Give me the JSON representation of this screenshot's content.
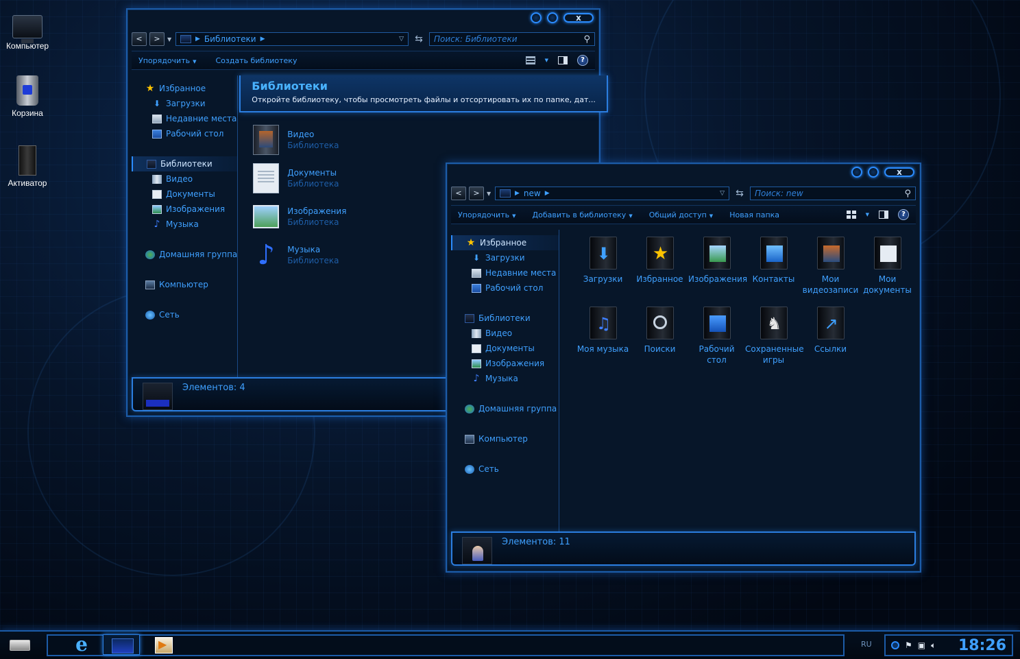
{
  "desktop": {
    "icons": [
      {
        "label": "Компьютер",
        "icon": "computer-icon"
      },
      {
        "label": "Корзина",
        "icon": "recycle-bin-icon"
      },
      {
        "label": "Активатор",
        "icon": "activator-icon"
      }
    ]
  },
  "window1": {
    "address": {
      "crumb": "Библиотеки"
    },
    "search_placeholder": "Поиск: Библиотеки",
    "toolbar": {
      "organize": "Упорядочить",
      "create_library": "Создать библиотеку"
    },
    "nav": {
      "favorites": "Избранное",
      "downloads": "Загрузки",
      "recent": "Недавние места",
      "desktop": "Рабочий стол",
      "libraries": "Библиотеки",
      "video": "Видео",
      "documents": "Документы",
      "images": "Изображения",
      "music": "Музыка",
      "homegroup": "Домашняя группа",
      "computer": "Компьютер",
      "network": "Сеть"
    },
    "banner": {
      "title": "Библиотеки",
      "subtitle": "Откройте библиотеку, чтобы просмотреть файлы и отсортировать их по папке, дат..."
    },
    "libraries": [
      {
        "name": "Видео",
        "type": "Библиотека"
      },
      {
        "name": "Документы",
        "type": "Библиотека"
      },
      {
        "name": "Изображения",
        "type": "Библиотека"
      },
      {
        "name": "Музыка",
        "type": "Библиотека"
      }
    ],
    "status": "Элементов: 4"
  },
  "window2": {
    "address": {
      "crumb": "new"
    },
    "search_placeholder": "Поиск: new",
    "toolbar": {
      "organize": "Упорядочить",
      "add_to_library": "Добавить в библиотеку",
      "share": "Общий доступ",
      "new_folder": "Новая папка"
    },
    "nav": {
      "favorites": "Избранное",
      "downloads": "Загрузки",
      "recent": "Недавние места",
      "desktop": "Рабочий стол",
      "libraries": "Библиотеки",
      "video": "Видео",
      "documents": "Документы",
      "images": "Изображения",
      "music": "Музыка",
      "homegroup": "Домашняя группа",
      "computer": "Компьютер",
      "network": "Сеть"
    },
    "folders": [
      {
        "label": "Загрузки",
        "icon": "downloads-folder-icon"
      },
      {
        "label": "Избранное",
        "icon": "favorites-folder-icon"
      },
      {
        "label": "Изображения",
        "icon": "images-folder-icon"
      },
      {
        "label": "Контакты",
        "icon": "contacts-folder-icon"
      },
      {
        "label": "Мои видеозаписи",
        "icon": "videos-folder-icon"
      },
      {
        "label": "Мои документы",
        "icon": "documents-folder-icon"
      },
      {
        "label": "Моя музыка",
        "icon": "music-folder-icon"
      },
      {
        "label": "Поиски",
        "icon": "searches-folder-icon"
      },
      {
        "label": "Рабочий стол",
        "icon": "desktop-folder-icon"
      },
      {
        "label": "Сохраненные игры",
        "icon": "saved-games-folder-icon"
      },
      {
        "label": "Ссылки",
        "icon": "links-folder-icon"
      }
    ],
    "status": "Элементов: 11"
  },
  "taskbar": {
    "lang": "RU",
    "clock": "18:26"
  },
  "caption": {
    "close": "x"
  },
  "colors": {
    "accent": "#3fa0ff",
    "border": "#1c5ca8",
    "background": "#020813"
  }
}
